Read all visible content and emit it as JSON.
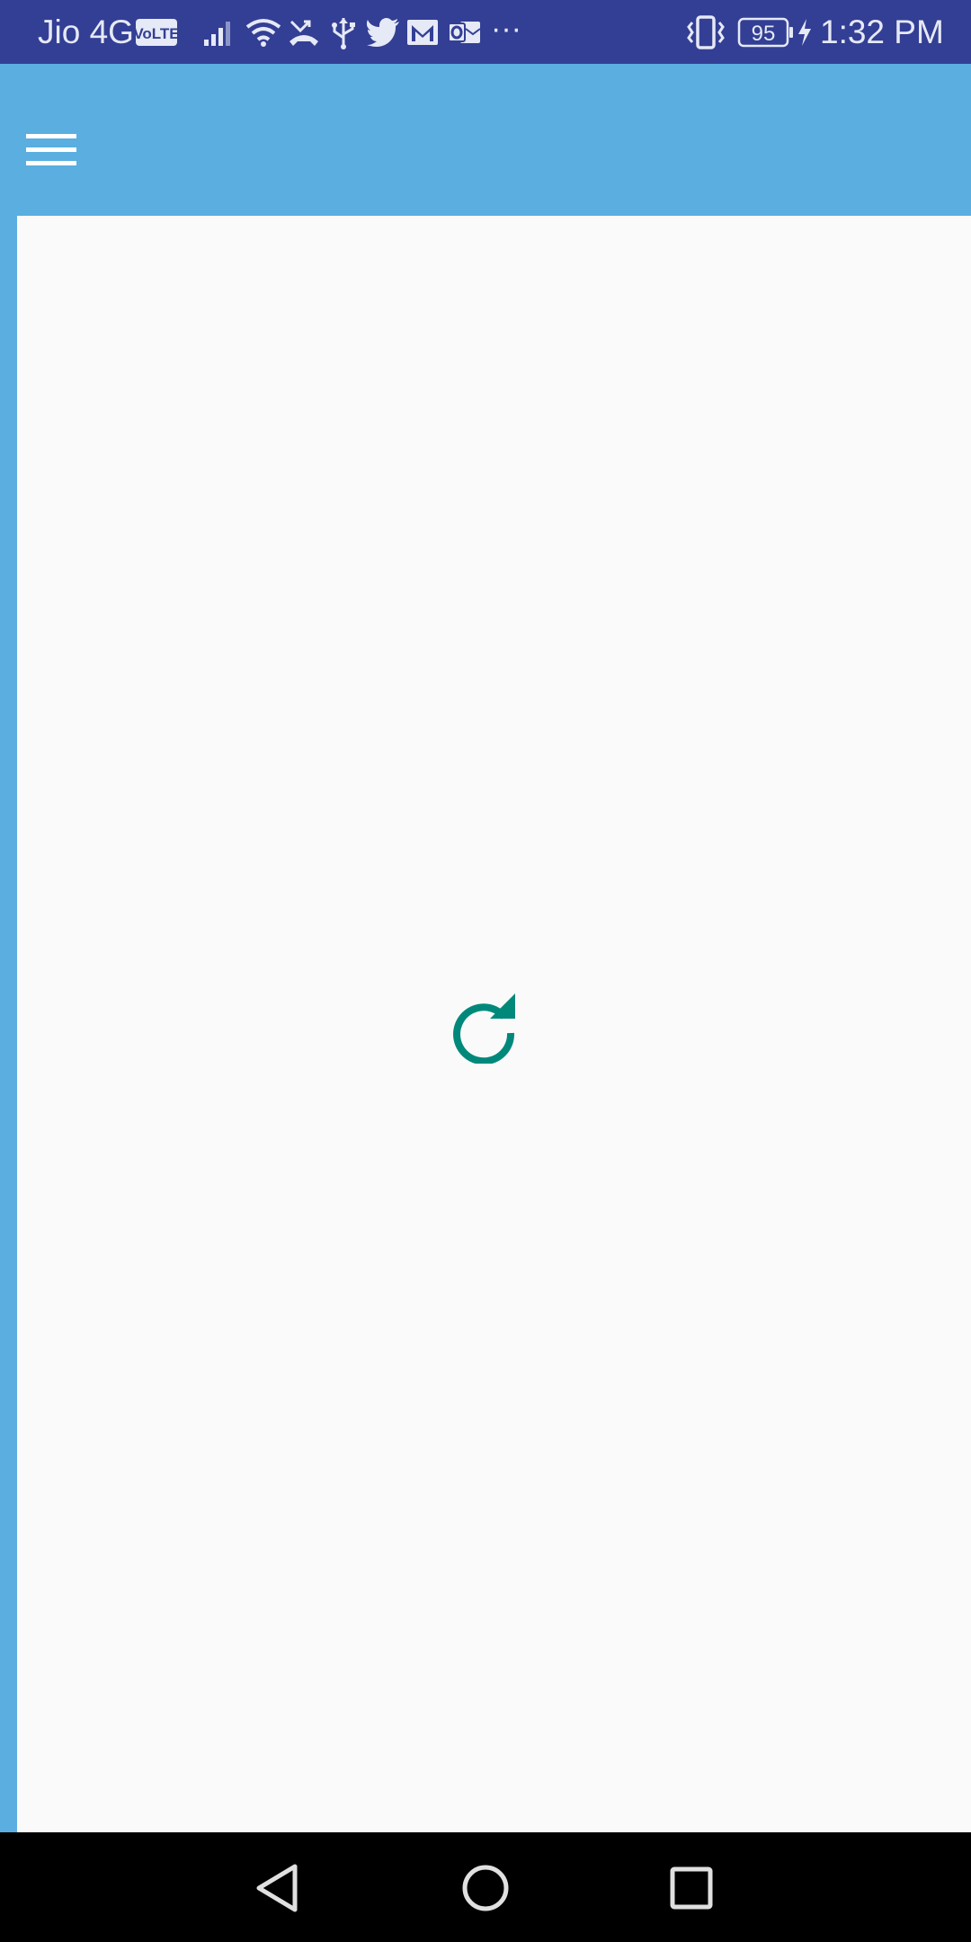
{
  "status_bar": {
    "carrier": "Jio 4G",
    "volte_badge": "VoLTE",
    "overflow": "···",
    "battery_level": "95",
    "time": "1:32 PM",
    "icons": [
      "signal-icon",
      "wifi-icon",
      "missed-call-icon",
      "usb-icon",
      "twitter-icon",
      "gmail-icon",
      "outlook-icon",
      "vibrate-icon",
      "battery-icon",
      "charging-icon"
    ]
  },
  "app_bar": {
    "menu_icon": "hamburger-menu-icon"
  },
  "content": {
    "refresh_icon": "refresh-icon"
  },
  "nav_bar": {
    "back_icon": "back-icon",
    "home_icon": "home-icon",
    "recents_icon": "recents-icon"
  },
  "colors": {
    "status_bar": "#333f94",
    "app_bar": "#5baee0",
    "content_bg": "#fafafa",
    "accent": "#00897b",
    "nav_bar": "#000000"
  }
}
